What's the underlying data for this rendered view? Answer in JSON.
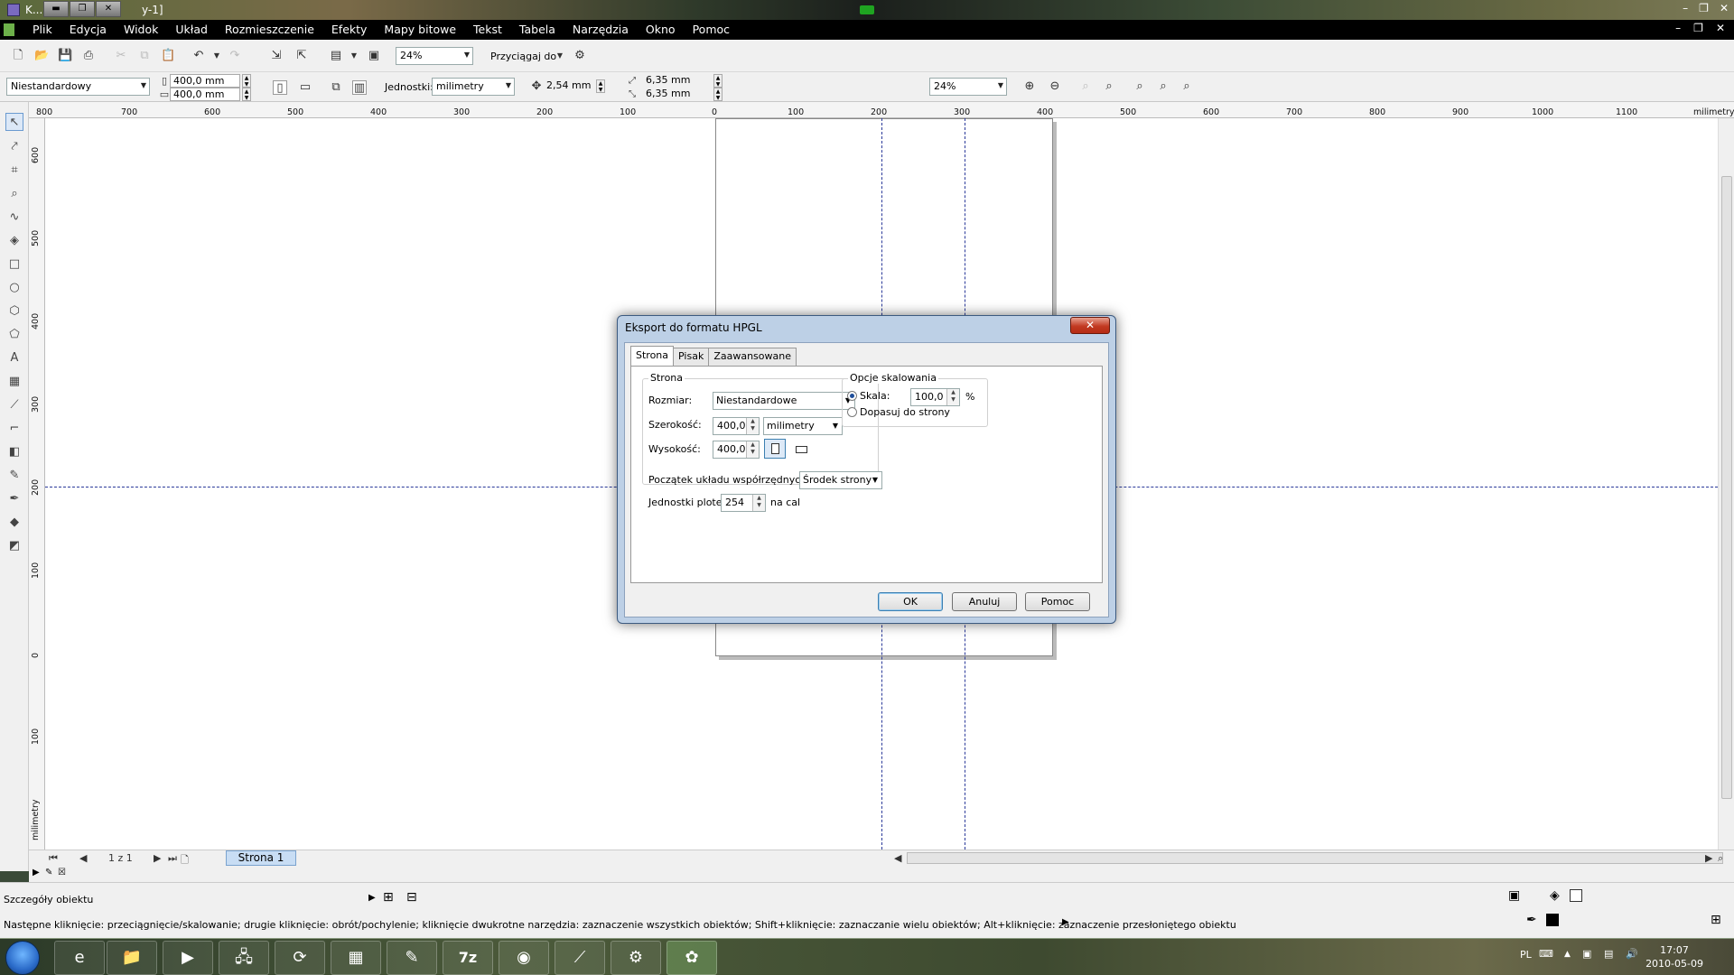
{
  "window": {
    "title_short": "K...",
    "title_tail": "y-1]",
    "controls": [
      "–",
      "❐",
      "✕"
    ]
  },
  "menu": {
    "items": [
      "Plik",
      "Edycja",
      "Widok",
      "Układ",
      "Rozmieszczenie",
      "Efekty",
      "Mapy bitowe",
      "Tekst",
      "Tabela",
      "Narzędzia",
      "Okno",
      "Pomoc"
    ],
    "mdi_controls": [
      "–",
      "❐",
      "✕"
    ]
  },
  "toolbar1": {
    "zoom": "24%",
    "snap_label": "Przyciągaj do"
  },
  "toolbar2": {
    "page_size": "Niestandardowy",
    "width": "400,0 mm",
    "height": "400,0 mm",
    "units_label": "Jednostki:",
    "units_value": "milimetry",
    "nudge": "2,54 mm",
    "dup_x": "6,35 mm",
    "dup_y": "6,35 mm",
    "zoom": "24%"
  },
  "ruler": {
    "h_ticks": [
      "800",
      "700",
      "600",
      "500",
      "400",
      "300",
      "200",
      "100",
      "0",
      "100",
      "200",
      "300",
      "400",
      "500",
      "600",
      "700",
      "800",
      "900",
      "1000",
      "1100"
    ],
    "h_unit": "milimetry",
    "v_ticks": [
      "600",
      "500",
      "400",
      "300",
      "200",
      "100",
      "0",
      "100"
    ],
    "v_unit": "milimetry"
  },
  "pagenav": {
    "counter": "1 z 1",
    "page_tab": "Strona 1"
  },
  "status": {
    "object_details": "Szczegóły obiektu",
    "hint": "Następne kliknięcie: przeciągnięcie/skalowanie; drugie kliknięcie: obrót/pochylenie; kliknięcie dwukrotne narzędzia: zaznaczenie wszystkich obiektów; Shift+kliknięcie: zaznaczanie wielu obiektów; Alt+kliknięcie: zaznaczenie przesłoniętego obiektu"
  },
  "dialog": {
    "title": "Eksport do formatu HPGL",
    "close": "✕",
    "tabs": [
      "Strona",
      "Pisak",
      "Zaawansowane"
    ],
    "strona_group": "Strona",
    "rozmiar_label": "Rozmiar:",
    "rozmiar_value": "Niestandardowe",
    "szerokosc_label": "Szerokość:",
    "szerokosc_value": "400,0",
    "units_value": "milimetry",
    "wysokosc_label": "Wysokość:",
    "wysokosc_value": "400,0",
    "scaling_group": "Opcje skalowania",
    "skala_label": "Skala:",
    "skala_value": "100,0",
    "percent": "%",
    "fit_label": "Dopasuj do strony",
    "origin_label": "Początek układu współrzędnych plotera:",
    "origin_value": "Środek strony",
    "plotter_units_label": "Jednostki plotera:",
    "plotter_units_value": "254",
    "per_inch": "na cal",
    "ok": "OK",
    "cancel": "Anuluj",
    "help": "Pomoc"
  },
  "taskbar": {
    "lang": "PL",
    "time": "17:07",
    "date": "2010-05-09",
    "apps": [
      "e",
      "📁",
      "▶",
      "🖧",
      "⟳",
      "▦",
      "✎",
      "7z",
      "◉",
      "⟋",
      "⚙",
      "✿"
    ]
  }
}
